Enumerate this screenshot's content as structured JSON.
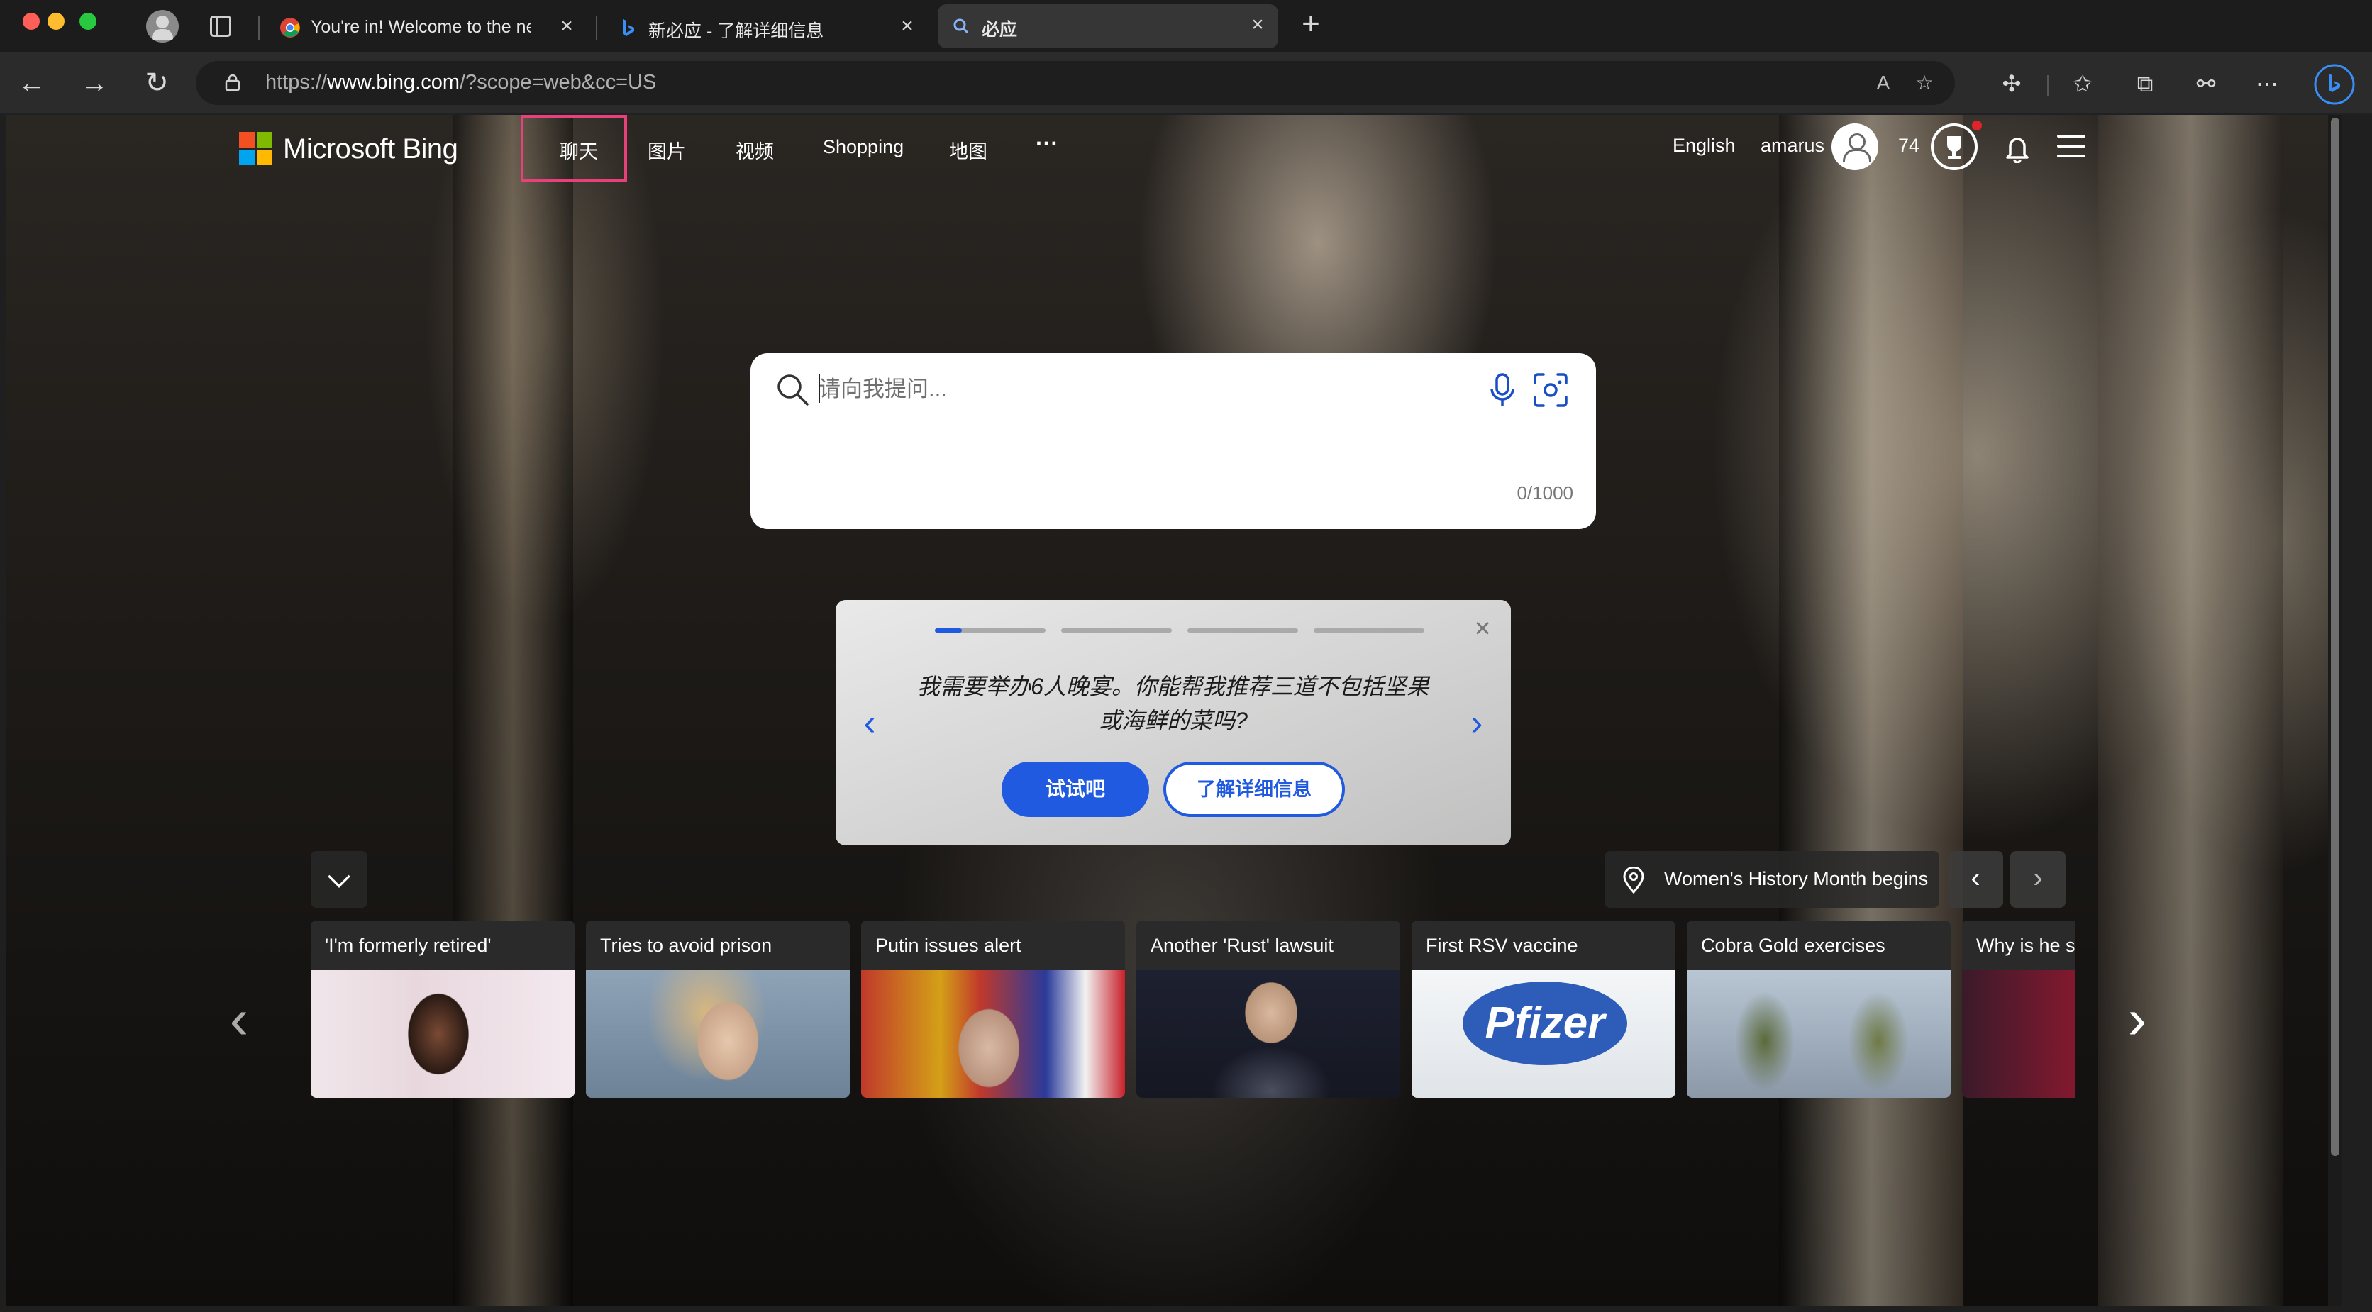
{
  "browser": {
    "tabs": [
      {
        "title": "You're in! Welcome to the new Bing!",
        "favicon": "chrome-icon"
      },
      {
        "title": "新必应 - 了解详细信息",
        "favicon": "bing-icon"
      },
      {
        "title": "必应",
        "favicon": "search-icon"
      }
    ],
    "url_prefix": "https://",
    "url_host": "www.bing.com",
    "url_path": "/?scope=web&cc=US"
  },
  "header": {
    "logo_text": "Microsoft Bing",
    "nav": [
      "聊天",
      "图片",
      "视频",
      "Shopping",
      "地图"
    ],
    "more": "···",
    "language": "English",
    "username": "amarus",
    "points": "74"
  },
  "search": {
    "placeholder": "请向我提问...",
    "counter": "0/1000"
  },
  "suggestion": {
    "text": "我需要举办6人晚宴。你能帮我推荐三道不包括坚果或海鲜的菜吗?",
    "try_label": "试试吧",
    "learn_label": "了解详细信息",
    "progress_total": 4,
    "progress_current": 1
  },
  "story": {
    "title": "Women's History Month begins"
  },
  "news": [
    {
      "title": "'I'm formerly retired'"
    },
    {
      "title": "Tries to avoid prison"
    },
    {
      "title": "Putin issues alert"
    },
    {
      "title": "Another 'Rust' lawsuit"
    },
    {
      "title": "First RSV vaccine",
      "logo": "Pfizer"
    },
    {
      "title": "Cobra Gold exercises"
    },
    {
      "title": "Why is he s"
    }
  ],
  "colors": {
    "accent": "#1f5ae0",
    "highlight": "#e8407a",
    "ms_red": "#f25022",
    "ms_green": "#7fba00",
    "ms_blue": "#00a4ef",
    "ms_yellow": "#ffb900"
  }
}
